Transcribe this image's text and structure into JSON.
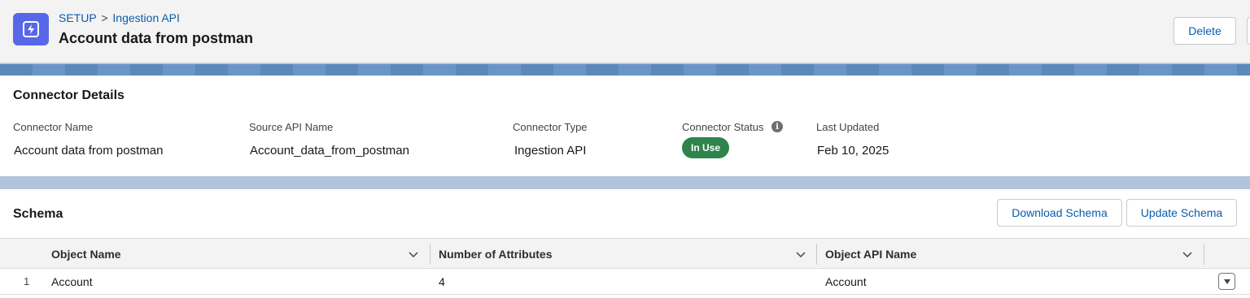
{
  "header": {
    "breadcrumb": {
      "root": "SETUP",
      "separator": ">",
      "current": "Ingestion API"
    },
    "title": "Account data from postman",
    "app_icon": "lightning-icon",
    "delete_label": "Delete"
  },
  "details": {
    "section_title": "Connector Details",
    "fields": [
      {
        "label": "Connector Name",
        "value": "Account data from postman"
      },
      {
        "label": "Source API Name",
        "value": "Account_data_from_postman"
      },
      {
        "label": "Connector Type",
        "value": "Ingestion API"
      },
      {
        "label": "Connector Status",
        "value": "In Use"
      },
      {
        "label": "Last Updated",
        "value": "Feb 10, 2025"
      }
    ],
    "status_color": "#2e844a"
  },
  "schema": {
    "section_title": "Schema",
    "download_label": "Download Schema",
    "update_label": "Update Schema",
    "columns": [
      "Object Name",
      "Number of Attributes",
      "Object API Name"
    ],
    "rows": [
      {
        "index": "1",
        "object_name": "Account",
        "attributes": "4",
        "api_name": "Account"
      }
    ]
  },
  "colors": {
    "accent": "#0b5cab",
    "app_icon_bg": "#5867e8"
  }
}
